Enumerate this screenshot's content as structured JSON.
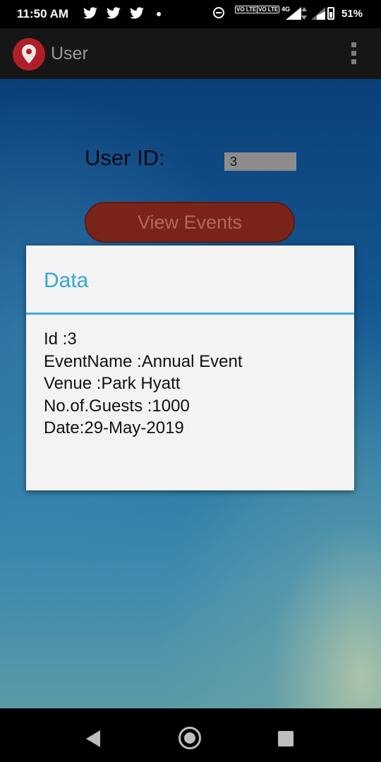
{
  "status_bar": {
    "time": "11:50 AM",
    "notification_icons": [
      "twitter-icon",
      "twitter-icon",
      "twitter-icon",
      "dot-icon"
    ],
    "sim1": "VO LTE",
    "sim2": "VO LTE",
    "network": "4G",
    "battery": "51%"
  },
  "app_bar": {
    "title": "User",
    "icon": "map-pin-icon",
    "menu_icon": "overflow-menu-icon"
  },
  "form": {
    "user_id_label": "User ID:",
    "user_id_value": "3",
    "view_events_button": "View Events"
  },
  "dialog": {
    "title": "Data",
    "lines": [
      "Id :3",
      "EventName :Annual Event",
      "Venue :Park Hyatt",
      "No.of.Guests :1000",
      "Date:29-May-2019"
    ]
  },
  "nav_bar": {
    "buttons": [
      "back-icon",
      "home-icon",
      "recents-icon"
    ]
  },
  "colors": {
    "app_icon_bg": "#b01f27",
    "button_bg": "#7a2419",
    "dialog_accent": "#37a7d1",
    "status_bg": "#000000"
  }
}
